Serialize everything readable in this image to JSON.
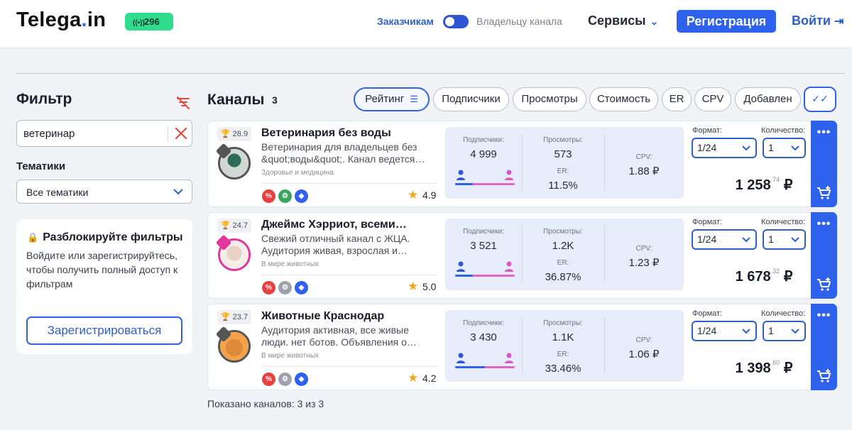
{
  "header": {
    "logo_main": "Telega",
    "logo_dot": ".",
    "logo_tail": "in",
    "online_count": "296",
    "online_icon": "broadcast-icon",
    "toggle_left": "Заказчикам",
    "toggle_right": "Владельцу канала",
    "services": "Сервисы",
    "register": "Регистрация",
    "login": "Войти",
    "login_icon": "sign-in-icon"
  },
  "filter": {
    "title": "Фильтр",
    "search_value": "ветеринар",
    "topics_label": "Тематики",
    "topics_value": "Все тематики",
    "unlock_title": "Разблокируйте фильтры",
    "unlock_desc": "Войдите или зарегистрируйтесь, чтобы получить полный доступ к фильтрам",
    "unlock_button": "Зарегистрироваться"
  },
  "channels": {
    "title": "Каналы",
    "count": "3",
    "sort_options": [
      "Рейтинг",
      "Подписчики",
      "Просмотры",
      "Стоимость",
      "ER",
      "CPV",
      "Добавлен"
    ],
    "active_sort": "Рейтинг",
    "shown_text": "Показано каналов: 3 из 3",
    "labels": {
      "subscribers": "Подписчики:",
      "views": "Просмотры:",
      "er": "ER:",
      "cpv": "CPV:",
      "format": "Формат:",
      "quantity": "Количество:",
      "currency": "₽"
    },
    "items": [
      {
        "rank": "28.9",
        "name": "Ветеринария без воды",
        "desc": "Ветеринария для владельцев без &quot;воды&quot;. Канал ведется…",
        "topic": "Здоровье и медицина",
        "rating": "4.9",
        "subscribers": "4 999",
        "views": "573",
        "er": "11.5%",
        "cpv": "1.88 ₽",
        "male_share": 0.3,
        "format": "1/24",
        "quantity": "1",
        "price_main": "1 258",
        "price_kop": ".74",
        "badge_color": "#555555"
      },
      {
        "rank": "24.7",
        "name": "Джеймс Хэрриот, всеми…",
        "desc": "Свежий отличный канал с ЖЦА. Аудитория живая, взрослая и…",
        "topic": "В мире животных",
        "rating": "5.0",
        "subscribers": "3 521",
        "views": "1.2K",
        "er": "36.87%",
        "cpv": "1.23 ₽",
        "male_share": 0.3,
        "format": "1/24",
        "quantity": "1",
        "price_main": "1 678",
        "price_kop": ".32",
        "badge_color": "#e3369b"
      },
      {
        "rank": "23.7",
        "name": "Животные Краснодар",
        "desc": "Аудитория активная, все живые люди. нет ботов. Объявления о…",
        "topic": "В мире животных",
        "rating": "4.2",
        "subscribers": "3 430",
        "views": "1.1K",
        "er": "33.46%",
        "cpv": "1.06 ₽",
        "male_share": 0.5,
        "format": "1/24",
        "quantity": "1",
        "price_main": "1 398",
        "price_kop": ".60",
        "badge_color": "#555555"
      }
    ]
  }
}
